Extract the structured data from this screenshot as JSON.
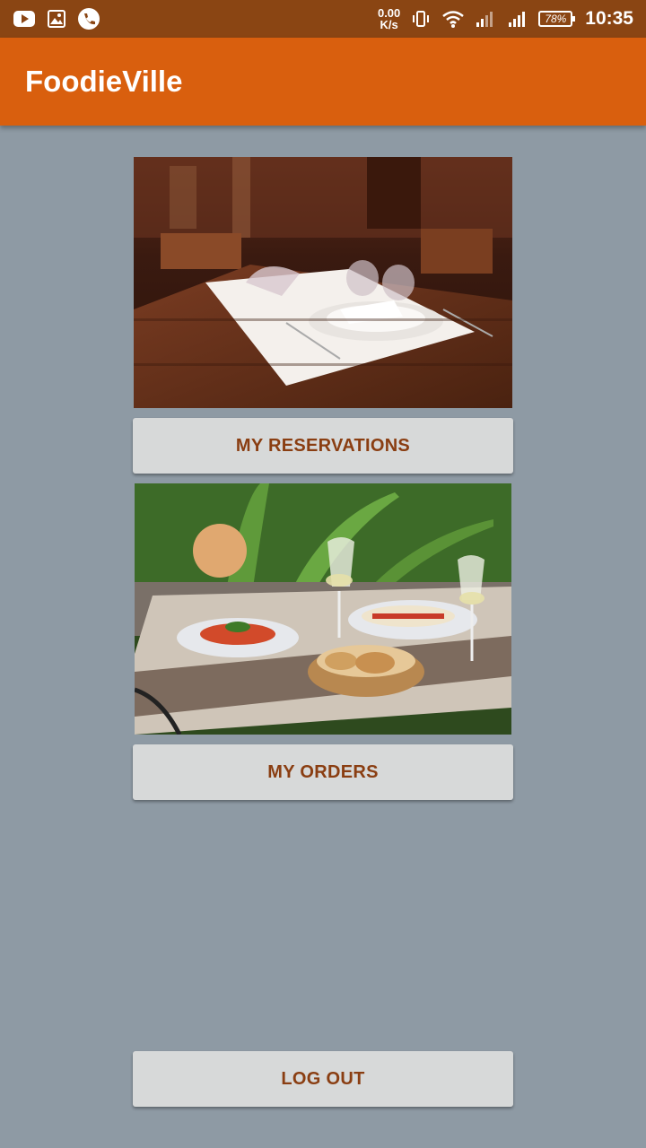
{
  "status_bar": {
    "net_speed_value": "0.00",
    "net_speed_unit": "K/s",
    "battery": "78%",
    "time": "10:35",
    "icons": [
      "youtube-icon",
      "gallery-icon",
      "phone-call-icon",
      "vibrate-icon",
      "wifi-icon",
      "signal-icon",
      "signal-icon",
      "battery-icon"
    ]
  },
  "app_bar": {
    "title": "FoodieVille"
  },
  "main": {
    "reservations_label": "MY RESERVATIONS",
    "orders_label": "MY ORDERS",
    "logout_label": "LOG OUT"
  },
  "colors": {
    "status_bar": "#8a4513",
    "app_bar": "#d95f0e",
    "background": "#8e9aa4",
    "button_bg": "#d7d9d9",
    "button_text": "#8a3e12"
  }
}
